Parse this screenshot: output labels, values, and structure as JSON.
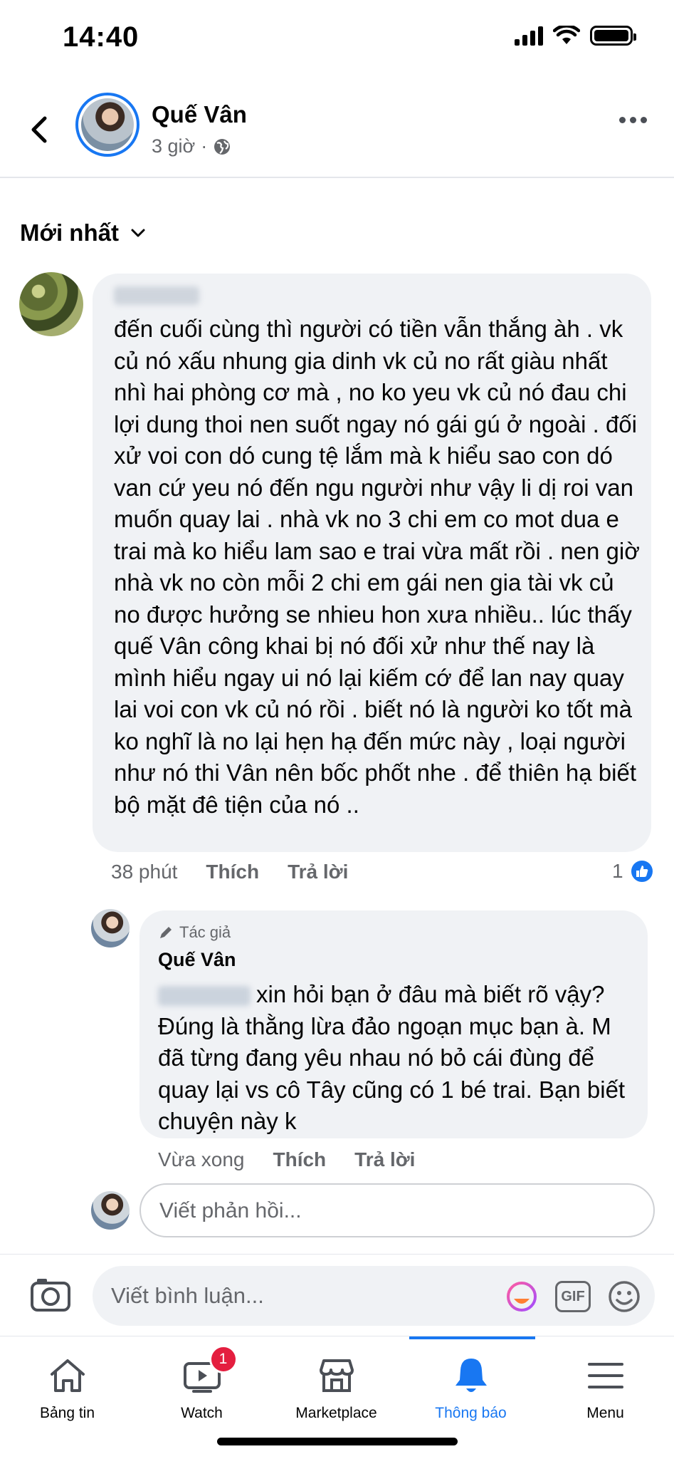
{
  "status_bar": {
    "time": "14:40"
  },
  "post_header": {
    "author_name": "Quế Vân",
    "time_ago": "3 giờ",
    "separator": "·"
  },
  "sort": {
    "label": "Mới nhất"
  },
  "comments": [
    {
      "text": "đến cuối cùng thì người có tiền vẫn thắng àh . vk củ nó xấu nhung gia dinh vk củ no rất giàu nhất nhì hai phòng cơ mà , no ko yeu vk củ nó đau chi lợi dung thoi nen suốt ngay nó gái gú ở ngoài . đối xử voi con dó cung tệ lắm mà k hiểu sao con dó van cứ yeu nó đến ngu người như vậy li dị roi van muốn quay lai . nhà vk no 3 chi em co mot dua e trai mà ko hiểu lam sao e trai vừa mất rồi . nen giờ nhà vk no còn mỗi 2 chi em gái nen gia tài vk củ no được hưởng se nhieu hon xưa nhiều.. lúc thấy quế Vân công khai bị nó đối xử như thế nay là mình hiểu ngay ui nó lại kiếm cớ để lan nay quay lai voi con vk củ nó rồi . biết nó là người ko tốt mà ko nghĩ là no lại hẹn hạ đến mức này , loại người  như nó thi Vân nên bốc phốt nhe . để thiên hạ biết bộ mặt đê tiện của nó ..",
      "time": "38 phút",
      "like_label": "Thích",
      "reply_label": "Trả lời",
      "like_count": "1"
    }
  ],
  "reply": {
    "badge": "Tác giả",
    "name": "Quế Vân",
    "text": "xin hỏi bạn ở đâu mà biết rõ vậy? Đúng là thằng lừa đảo ngoạn mục bạn à. M đã từng đang yêu nhau nó bỏ cái đùng để quay lại vs cô Tây cũng có 1 bé trai. Bạn biết chuyện này k",
    "time": "Vừa xong",
    "like_label": "Thích",
    "reply_label": "Trả lời"
  },
  "reply_input": {
    "placeholder": "Viết phản hồi..."
  },
  "composer": {
    "placeholder": "Viết bình luận...",
    "gif_label": "GIF"
  },
  "bottom_nav": {
    "items": [
      {
        "label": "Bảng tin",
        "icon": "home-icon"
      },
      {
        "label": "Watch",
        "icon": "watch-icon",
        "badge": "1"
      },
      {
        "label": "Marketplace",
        "icon": "marketplace-icon"
      },
      {
        "label": "Thông báo",
        "icon": "bell-icon",
        "active": true
      },
      {
        "label": "Menu",
        "icon": "menu-icon"
      }
    ]
  },
  "colors": {
    "accent": "#1877f2",
    "bubble": "#f0f2f5",
    "badge": "#e41e3f",
    "secondary_text": "#65676b"
  }
}
